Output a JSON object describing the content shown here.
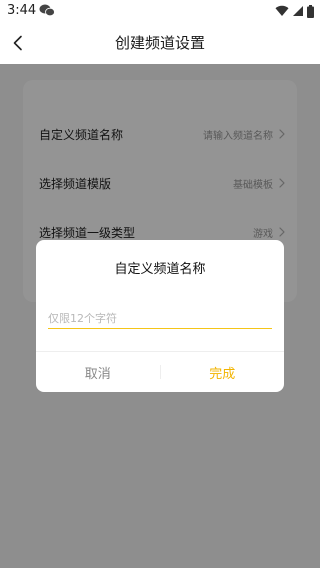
{
  "status_bar": {
    "time": "3:44",
    "icons": [
      "wechat-icon",
      "wifi-icon",
      "signal-icon",
      "battery-icon"
    ]
  },
  "header": {
    "title": "创建频道设置",
    "back_icon": "chevron-left-icon"
  },
  "settings": {
    "items": [
      {
        "label": "自定义频道名称",
        "value": "请输入频道名称"
      },
      {
        "label": "选择频道模版",
        "value": "基础模板"
      },
      {
        "label": "选择频道一级类型",
        "value": "游戏"
      }
    ]
  },
  "dialog": {
    "title": "自定义频道名称",
    "input_value": "",
    "input_placeholder": "仅限12个字符",
    "cancel_label": "取消",
    "confirm_label": "完成"
  },
  "colors": {
    "accent": "#f2b400",
    "input_underline": "#f5c518",
    "overlay": "rgba(0,0,0,0.42)"
  }
}
